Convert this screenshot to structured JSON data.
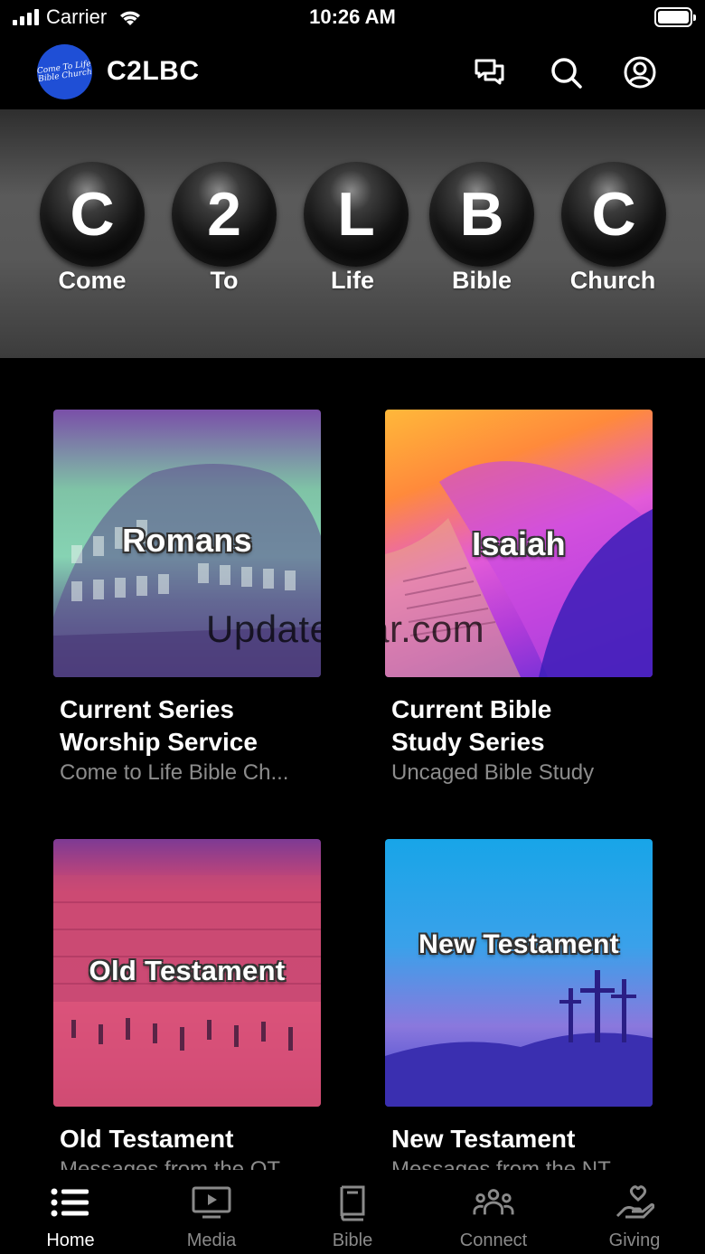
{
  "status_bar": {
    "carrier": "Carrier",
    "time": "10:26 AM"
  },
  "header": {
    "title": "C2LBC",
    "logo_text": "Come To Life Bible Church",
    "icons": [
      "chat-icon",
      "search-icon",
      "account-icon"
    ]
  },
  "banner": {
    "letters": [
      {
        "letter": "C",
        "word": "Come"
      },
      {
        "letter": "2",
        "word": "To"
      },
      {
        "letter": "L",
        "word": "Life"
      },
      {
        "letter": "B",
        "word": "Bible"
      },
      {
        "letter": "C",
        "word": "Church"
      }
    ]
  },
  "cards": [
    {
      "overlay": "Romans",
      "title_line1": "Current Series",
      "title_line2": "Worship Service",
      "subtitle": "Come to Life Bible Ch..."
    },
    {
      "overlay": "Isaiah",
      "title_line1": "Current Bible",
      "title_line2": "Study Series",
      "subtitle": "Uncaged Bible Study"
    },
    {
      "overlay": "Old Testament",
      "title_line1": "Old Testament",
      "subtitle": "Messages from the OT"
    },
    {
      "overlay": "New Testament",
      "title_line1": "New Testament",
      "subtitle": "Messages from the NT"
    }
  ],
  "watermark": "UpdateStar.com",
  "tabs": [
    {
      "label": "Home",
      "icon": "list-icon",
      "active": true
    },
    {
      "label": "Media",
      "icon": "tv-play-icon",
      "active": false
    },
    {
      "label": "Bible",
      "icon": "book-icon",
      "active": false
    },
    {
      "label": "Connect",
      "icon": "people-icon",
      "active": false
    },
    {
      "label": "Giving",
      "icon": "heart-hand-icon",
      "active": false
    }
  ],
  "colors": {
    "background": "#000000",
    "logo_blue": "#1f4fd6",
    "subtitle_gray": "#8c8c8c",
    "inactive_tab": "#8a8a8a"
  }
}
